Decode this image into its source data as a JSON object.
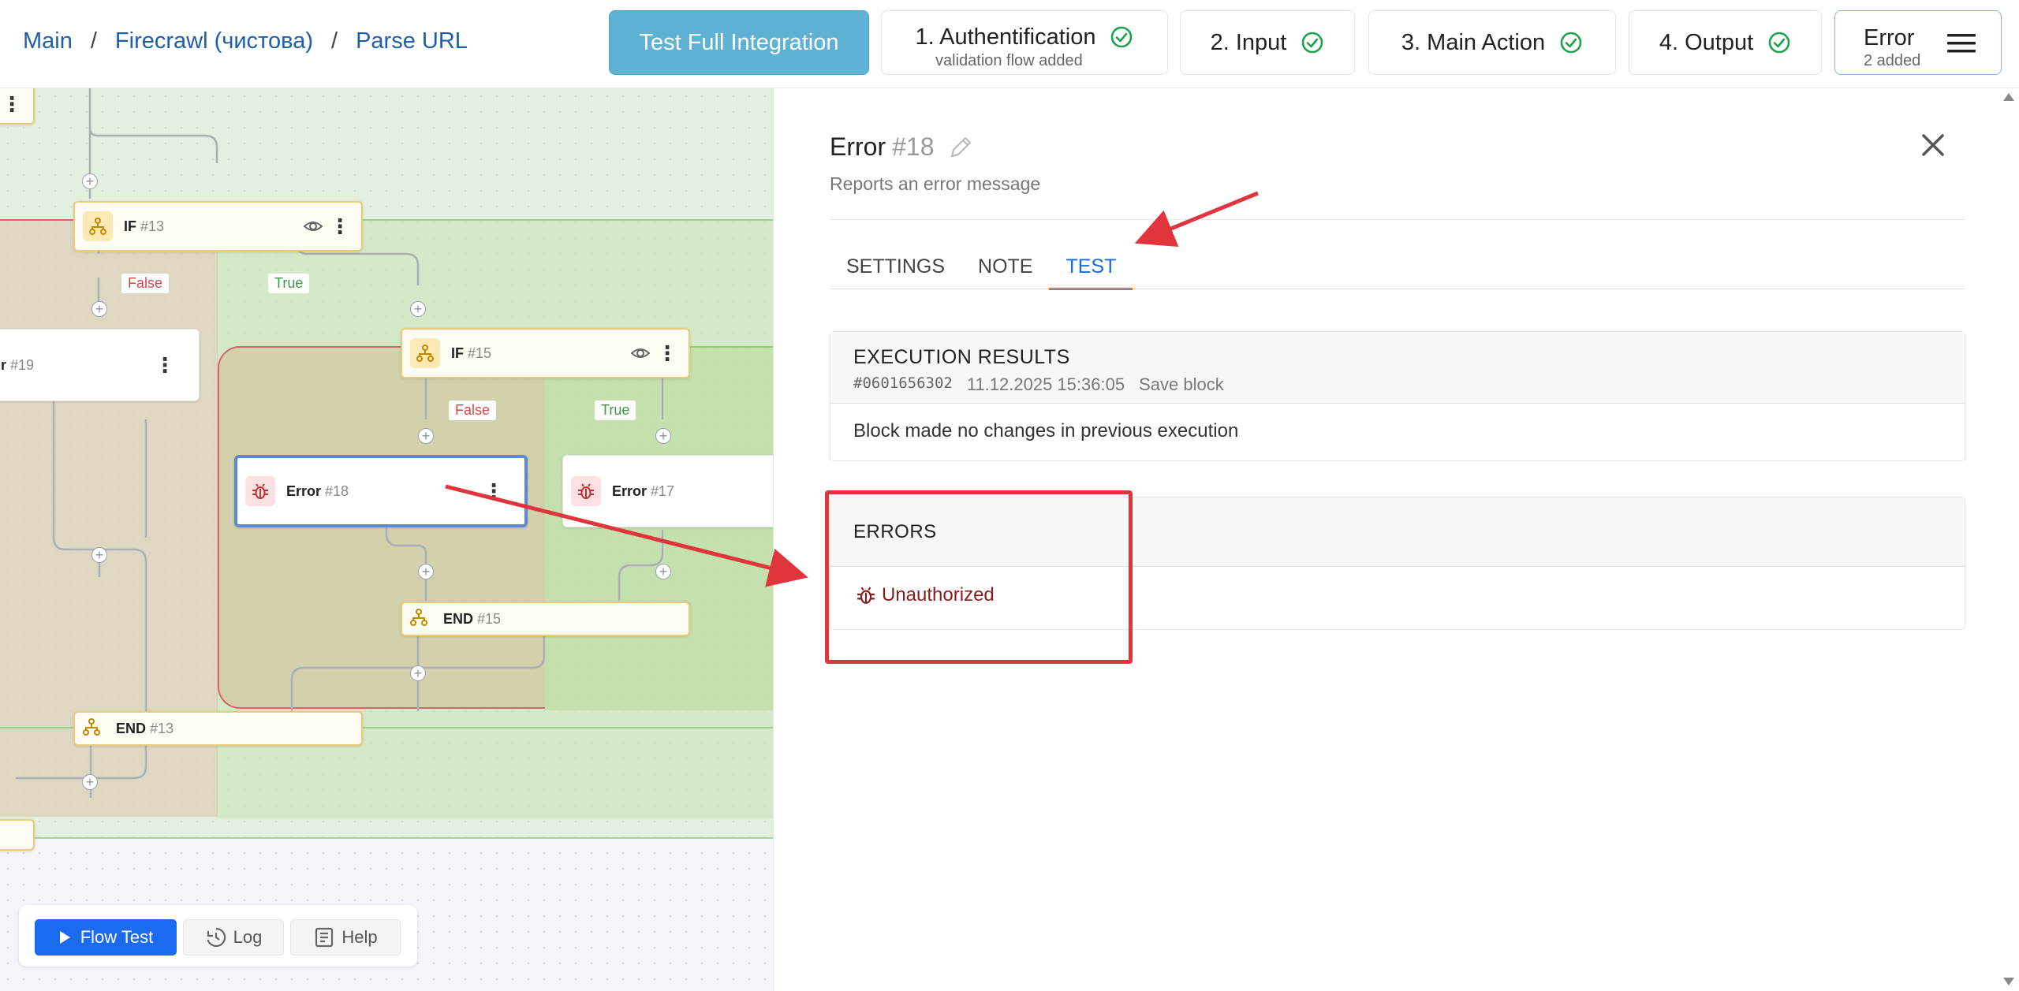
{
  "breadcrumb": {
    "items": [
      "Main",
      "Firecrawl (чистова)",
      "Parse URL"
    ],
    "sep": "/"
  },
  "header": {
    "test_full_label": "Test Full Integration",
    "steps": [
      {
        "label": "1. Authentification",
        "sub": "validation flow added"
      },
      {
        "label": "2. Input",
        "sub": ""
      },
      {
        "label": "3. Main Action",
        "sub": ""
      },
      {
        "label": "4. Output",
        "sub": ""
      }
    ],
    "error_step": {
      "label": "Error",
      "sub": "2 added"
    }
  },
  "canvas": {
    "nodes": {
      "if13": {
        "label": "IF",
        "num": "#13"
      },
      "if15": {
        "label": "IF",
        "num": "#15"
      },
      "err19": {
        "label": "r",
        "num": "#19"
      },
      "err18": {
        "label": "Error",
        "num": "#18"
      },
      "err17": {
        "label": "Error",
        "num": "#17"
      },
      "end15": {
        "label": "END",
        "num": "#15"
      },
      "end13": {
        "label": "END",
        "num": "#13"
      }
    },
    "branches": {
      "false": "False",
      "true": "True"
    },
    "plus": "+",
    "kebab": "⋮"
  },
  "bottom_bar": {
    "flow_test": "Flow Test",
    "log": "Log",
    "help": "Help"
  },
  "panel": {
    "title": "Error",
    "title_num": "#18",
    "description": "Reports an error message",
    "tabs": [
      "SETTINGS",
      "NOTE",
      "TEST"
    ],
    "active_tab": "TEST",
    "execution": {
      "title": "EXECUTION RESULTS",
      "id": "#0601656302",
      "timestamp": "11.12.2025 15:36:05",
      "action": "Save block",
      "body": "Block made no changes in previous execution"
    },
    "errors": {
      "title": "ERRORS",
      "items": [
        "Unauthorized"
      ]
    }
  },
  "colors": {
    "accent": "#1a6bd9",
    "annotation": "#e0353d",
    "test_full": "#5fb2d3",
    "error_text": "#8a1c1c"
  }
}
